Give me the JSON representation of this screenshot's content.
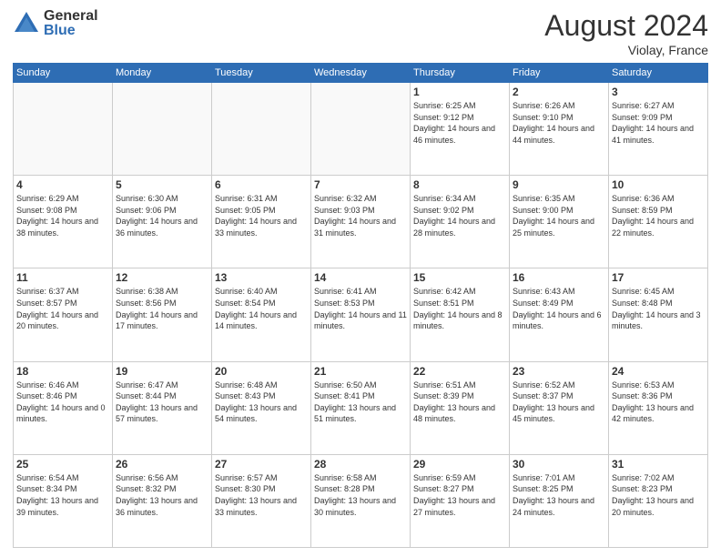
{
  "header": {
    "logo_general": "General",
    "logo_blue": "Blue",
    "month_title": "August 2024",
    "location": "Violay, France"
  },
  "days_of_week": [
    "Sunday",
    "Monday",
    "Tuesday",
    "Wednesday",
    "Thursday",
    "Friday",
    "Saturday"
  ],
  "weeks": [
    [
      {
        "day": "",
        "info": ""
      },
      {
        "day": "",
        "info": ""
      },
      {
        "day": "",
        "info": ""
      },
      {
        "day": "",
        "info": ""
      },
      {
        "day": "1",
        "info": "Sunrise: 6:25 AM\nSunset: 9:12 PM\nDaylight: 14 hours and 46 minutes."
      },
      {
        "day": "2",
        "info": "Sunrise: 6:26 AM\nSunset: 9:10 PM\nDaylight: 14 hours and 44 minutes."
      },
      {
        "day": "3",
        "info": "Sunrise: 6:27 AM\nSunset: 9:09 PM\nDaylight: 14 hours and 41 minutes."
      }
    ],
    [
      {
        "day": "4",
        "info": "Sunrise: 6:29 AM\nSunset: 9:08 PM\nDaylight: 14 hours and 38 minutes."
      },
      {
        "day": "5",
        "info": "Sunrise: 6:30 AM\nSunset: 9:06 PM\nDaylight: 14 hours and 36 minutes."
      },
      {
        "day": "6",
        "info": "Sunrise: 6:31 AM\nSunset: 9:05 PM\nDaylight: 14 hours and 33 minutes."
      },
      {
        "day": "7",
        "info": "Sunrise: 6:32 AM\nSunset: 9:03 PM\nDaylight: 14 hours and 31 minutes."
      },
      {
        "day": "8",
        "info": "Sunrise: 6:34 AM\nSunset: 9:02 PM\nDaylight: 14 hours and 28 minutes."
      },
      {
        "day": "9",
        "info": "Sunrise: 6:35 AM\nSunset: 9:00 PM\nDaylight: 14 hours and 25 minutes."
      },
      {
        "day": "10",
        "info": "Sunrise: 6:36 AM\nSunset: 8:59 PM\nDaylight: 14 hours and 22 minutes."
      }
    ],
    [
      {
        "day": "11",
        "info": "Sunrise: 6:37 AM\nSunset: 8:57 PM\nDaylight: 14 hours and 20 minutes."
      },
      {
        "day": "12",
        "info": "Sunrise: 6:38 AM\nSunset: 8:56 PM\nDaylight: 14 hours and 17 minutes."
      },
      {
        "day": "13",
        "info": "Sunrise: 6:40 AM\nSunset: 8:54 PM\nDaylight: 14 hours and 14 minutes."
      },
      {
        "day": "14",
        "info": "Sunrise: 6:41 AM\nSunset: 8:53 PM\nDaylight: 14 hours and 11 minutes."
      },
      {
        "day": "15",
        "info": "Sunrise: 6:42 AM\nSunset: 8:51 PM\nDaylight: 14 hours and 8 minutes."
      },
      {
        "day": "16",
        "info": "Sunrise: 6:43 AM\nSunset: 8:49 PM\nDaylight: 14 hours and 6 minutes."
      },
      {
        "day": "17",
        "info": "Sunrise: 6:45 AM\nSunset: 8:48 PM\nDaylight: 14 hours and 3 minutes."
      }
    ],
    [
      {
        "day": "18",
        "info": "Sunrise: 6:46 AM\nSunset: 8:46 PM\nDaylight: 14 hours and 0 minutes."
      },
      {
        "day": "19",
        "info": "Sunrise: 6:47 AM\nSunset: 8:44 PM\nDaylight: 13 hours and 57 minutes."
      },
      {
        "day": "20",
        "info": "Sunrise: 6:48 AM\nSunset: 8:43 PM\nDaylight: 13 hours and 54 minutes."
      },
      {
        "day": "21",
        "info": "Sunrise: 6:50 AM\nSunset: 8:41 PM\nDaylight: 13 hours and 51 minutes."
      },
      {
        "day": "22",
        "info": "Sunrise: 6:51 AM\nSunset: 8:39 PM\nDaylight: 13 hours and 48 minutes."
      },
      {
        "day": "23",
        "info": "Sunrise: 6:52 AM\nSunset: 8:37 PM\nDaylight: 13 hours and 45 minutes."
      },
      {
        "day": "24",
        "info": "Sunrise: 6:53 AM\nSunset: 8:36 PM\nDaylight: 13 hours and 42 minutes."
      }
    ],
    [
      {
        "day": "25",
        "info": "Sunrise: 6:54 AM\nSunset: 8:34 PM\nDaylight: 13 hours and 39 minutes."
      },
      {
        "day": "26",
        "info": "Sunrise: 6:56 AM\nSunset: 8:32 PM\nDaylight: 13 hours and 36 minutes."
      },
      {
        "day": "27",
        "info": "Sunrise: 6:57 AM\nSunset: 8:30 PM\nDaylight: 13 hours and 33 minutes."
      },
      {
        "day": "28",
        "info": "Sunrise: 6:58 AM\nSunset: 8:28 PM\nDaylight: 13 hours and 30 minutes."
      },
      {
        "day": "29",
        "info": "Sunrise: 6:59 AM\nSunset: 8:27 PM\nDaylight: 13 hours and 27 minutes."
      },
      {
        "day": "30",
        "info": "Sunrise: 7:01 AM\nSunset: 8:25 PM\nDaylight: 13 hours and 24 minutes."
      },
      {
        "day": "31",
        "info": "Sunrise: 7:02 AM\nSunset: 8:23 PM\nDaylight: 13 hours and 20 minutes."
      }
    ]
  ]
}
